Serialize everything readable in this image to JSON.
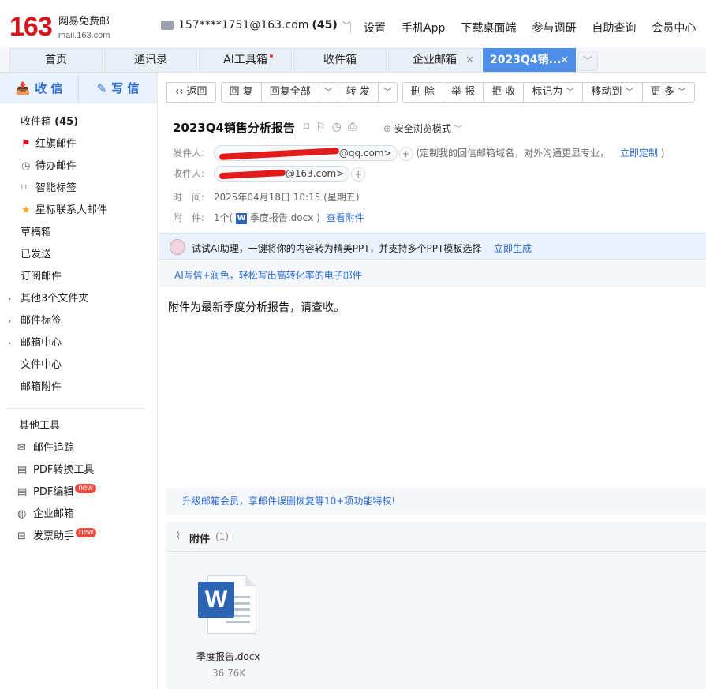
{
  "brand": {
    "logo_number": "163",
    "logo_name": "网易免费邮",
    "logo_domain": "mail.163.com"
  },
  "account": {
    "email": "157****1751@163.com",
    "unread": "(45)"
  },
  "topnav": [
    "设置",
    "手机App",
    "下载桌面端",
    "参与调研",
    "自助查询",
    "会员中心"
  ],
  "tabs": [
    "首页",
    "通讯录",
    "AI工具箱",
    "收件箱",
    "企业邮箱",
    "2023Q4销..."
  ],
  "compose": {
    "receive": "收 信",
    "write": "写 信"
  },
  "folders": {
    "inbox": "收件箱",
    "inbox_count": "(45)",
    "flagged": "红旗邮件",
    "todo": "待办邮件",
    "smart_tags": "智能标签",
    "starred": "星标联系人邮件",
    "drafts": "草稿箱",
    "sent": "已发送",
    "subscriptions": "订阅邮件",
    "other_folders": "其他3个文件夹",
    "mail_tags": "邮件标签",
    "mail_center": "邮箱中心",
    "file_center": "文件中心",
    "mail_attachments": "邮箱附件"
  },
  "tools": {
    "header": "其他工具",
    "tracking": "邮件追踪",
    "pdf_convert": "PDF转换工具",
    "pdf_edit": "PDF编辑",
    "enterprise": "企业邮箱",
    "invoice": "发票助手",
    "new_badge": "new"
  },
  "toolbar": {
    "back": "返回",
    "reply": "回 复",
    "reply_all": "回复全部",
    "forward": "转 发",
    "delete": "删 除",
    "report": "举 报",
    "reject": "拒 收",
    "mark_as": "标记为",
    "move_to": "移动到",
    "more": "更 多"
  },
  "message": {
    "subject": "2023Q4销售分析报告",
    "safe_mode": "安全浏览模式",
    "from_label": "发件人:",
    "from_domain": "@qq.com>",
    "from_note": "(定制我的回信邮箱域名，对外沟通更显专业，",
    "from_link": "立即定制",
    "from_close": ")",
    "to_label": "收件人:",
    "to_domain": "@163.com>",
    "time_label": "时　间:",
    "time_value": "2025年04月18日 10:15 (星期五)",
    "attach_label": "附　件:",
    "attach_summary_pre": "1个(",
    "attach_summary_file": "季度报告.docx )",
    "attach_view": "查看附件",
    "body": "附件为最新季度分析报告，请查收。"
  },
  "ai_banner": {
    "text": "试试AI助理，一键将你的内容转为精美PPT，并支持多个PPT模板选择",
    "action": "立即生成"
  },
  "ai_write": "AI写信+润色，轻松写出高转化率的电子邮件",
  "promo": "升级邮箱会员，享邮件误删恢复等10+项功能特权!",
  "attachments": {
    "title": "附件",
    "count": "(1)",
    "files": [
      {
        "name": "季度报告.docx",
        "size": "36.76K",
        "type": "word-icon"
      }
    ]
  }
}
